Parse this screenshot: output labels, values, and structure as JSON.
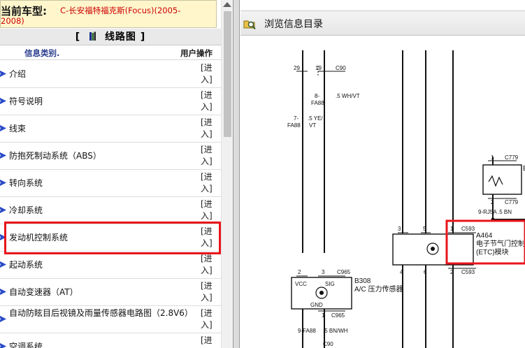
{
  "header": {
    "label": "当前车型:",
    "vehicle_line1": "C-长安福特福克斯(Focus)(2005-",
    "vehicle_line2": "2008)"
  },
  "section": {
    "left_bracket": "[",
    "title": "线路图",
    "right_bracket": "]"
  },
  "columns": {
    "category": "信息类别.",
    "action": "用户操作"
  },
  "items": [
    {
      "label": "介绍",
      "action": "[进入]"
    },
    {
      "label": "符号说明",
      "action": "[进入]"
    },
    {
      "label": "线束",
      "action": "[进入]"
    },
    {
      "label": "防抱死制动系统（ABS）",
      "action": "[进入]"
    },
    {
      "label": "转向系统",
      "action": "[进入]"
    },
    {
      "label": "冷却系统",
      "action": "[进入]"
    },
    {
      "label": "发动机控制系统",
      "action": "[进入]"
    },
    {
      "label": "起动系统",
      "action": "[进入]"
    },
    {
      "label": "自动变速器（AT）",
      "action": "[进入]"
    },
    {
      "label": "自动防眩目后视镜及雨量传感器电路图（2.8V6）",
      "action": "[进入]"
    },
    {
      "label": "空调系统",
      "action": "[进入]"
    }
  ],
  "right_panel": {
    "toolbar_title": "浏览信息目录",
    "diagram": {
      "pin_29": "29",
      "pin_19": "19",
      "conn_c90_top": "C90",
      "pin_8": "8-",
      "fa88_a": "FA88",
      "wire_wh_vt": ".5 WH/VT",
      "pin_7": "7-",
      "fa88_b": "FA88",
      "wire_ye": ".5 YE/",
      "wire_vt": "VT",
      "pin_1_top": "1",
      "conn_c779_top": "C779",
      "pin_2_mid": "2",
      "conn_c779_bot": "C779",
      "rj5a": "9-RJ5A",
      "wire_5bn": ".5 BN",
      "pin_3": "3",
      "pin_5": "5",
      "pin_1_b": "1",
      "conn_c593_top": "C593",
      "comp_a464": "A464",
      "comp_a464_desc1": "电子节气门控制",
      "comp_a464_desc2": "(ETC)模块",
      "pin_4": "4",
      "pin_6": "6",
      "pin_2_r": "2",
      "conn_c593_bot": "C593",
      "pin_2_b308": "2",
      "pin_3_b308": "3",
      "conn_c965_top": "C965",
      "comp_b308": "B308",
      "comp_b308_desc": "A/C 压力传感器",
      "vcc": "VCC",
      "sig": "SIG",
      "gnd": "GND",
      "pin_1_bot": "1",
      "conn_c965_bot": "C965",
      "fa88_c": "9-FA88",
      "wire_bn_wh": ".5 BN/WH",
      "conn_c90_bot": "C90",
      "edge_b": "E"
    }
  },
  "colors": {
    "header_bg": "#fff6cc",
    "vehicle_text": "#cc0000",
    "highlight": "#e8151b",
    "arrow": "#2b4cc8"
  },
  "icons": {
    "arrow": "blue-arrow-icon",
    "book": "book-icon",
    "browse": "browse-folder-icon"
  }
}
